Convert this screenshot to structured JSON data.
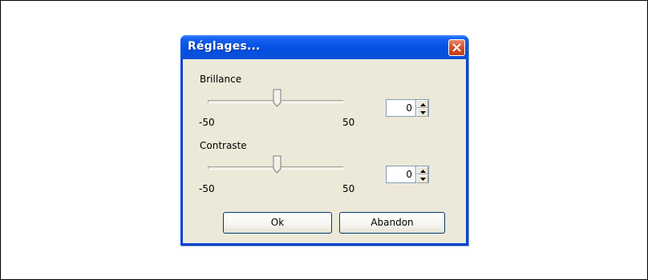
{
  "dialog": {
    "title": "Réglages...",
    "close_icon": "close-x-icon"
  },
  "brillance": {
    "label": "Brillance",
    "min_label": "-50",
    "max_label": "50",
    "min": -50,
    "max": 50,
    "value": 0,
    "spin_value": "0"
  },
  "contraste": {
    "label": "Contraste",
    "min_label": "-50",
    "max_label": "50",
    "min": -50,
    "max": 50,
    "value": 0,
    "spin_value": "0"
  },
  "buttons": {
    "ok": "Ok",
    "cancel": "Abandon"
  },
  "colors": {
    "titlebar": "#0650e0",
    "client_bg": "#ece9d8",
    "close_button": "#d9542d"
  }
}
